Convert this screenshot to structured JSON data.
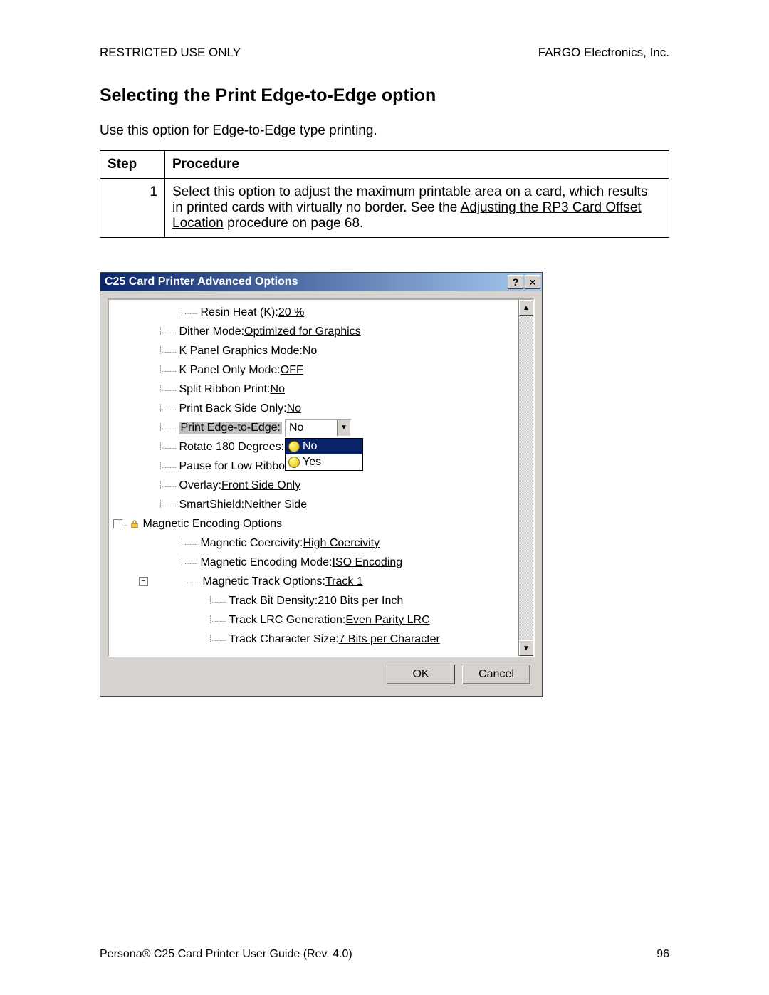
{
  "header": {
    "left": "RESTRICTED USE ONLY",
    "right": "FARGO Electronics, Inc."
  },
  "title": "Selecting the Print Edge-to-Edge option",
  "intro": "Use this option for Edge-to-Edge type printing.",
  "table": {
    "head_step": "Step",
    "head_proc": "Procedure",
    "step_no": "1",
    "proc_a": "Select this option to adjust the maximum printable area on a card, which results in printed cards with virtually no border.  See the ",
    "proc_link": "Adjusting the RP3 Card Offset Location",
    "proc_b": " procedure on page 68."
  },
  "dialog": {
    "title": "C25 Card Printer Advanced Options",
    "help": "?",
    "close": "×",
    "ok": "OK",
    "cancel": "Cancel",
    "combo_value": "No",
    "dd_no": "No",
    "dd_yes": "Yes",
    "rows": {
      "r0_l": "Resin Heat (K): ",
      "r0_v": "20 %",
      "r1_l": "Dither Mode: ",
      "r1_v": "Optimized for Graphics",
      "r2_l": "K Panel Graphics Mode: ",
      "r2_v": "No",
      "r3_l": "K Panel Only Mode: ",
      "r3_v": "OFF",
      "r4_l": "Split Ribbon Print: ",
      "r4_v": "No",
      "r5_l": "Print Back Side Only: ",
      "r5_v": "No",
      "r6_l": "Print Edge-to-Edge: ",
      "r7_l": "Rotate 180 Degrees: ",
      "r8_l": "Pause for Low Ribbon",
      "r9_l": "Overlay: ",
      "r9_v": "Front Side Only",
      "r10_l": "SmartShield: ",
      "r10_v": "Neither Side",
      "r11_l": "Magnetic Encoding Options",
      "r12_l": "Magnetic Coercivity: ",
      "r12_v": "High Coercivity",
      "r13_l": "Magnetic Encoding Mode: ",
      "r13_v": "ISO Encoding",
      "r14_l": "Magnetic Track Options: ",
      "r14_v": "Track 1",
      "r15_l": "Track Bit Density: ",
      "r15_v": "210 Bits per Inch",
      "r16_l": "Track LRC Generation: ",
      "r16_v": "Even Parity LRC",
      "r17_l": "Track Character Size: ",
      "r17_v": "7 Bits per Character"
    }
  },
  "footer": {
    "left": "Persona® C25 Card Printer User Guide (Rev. 4.0)",
    "right": "96"
  }
}
